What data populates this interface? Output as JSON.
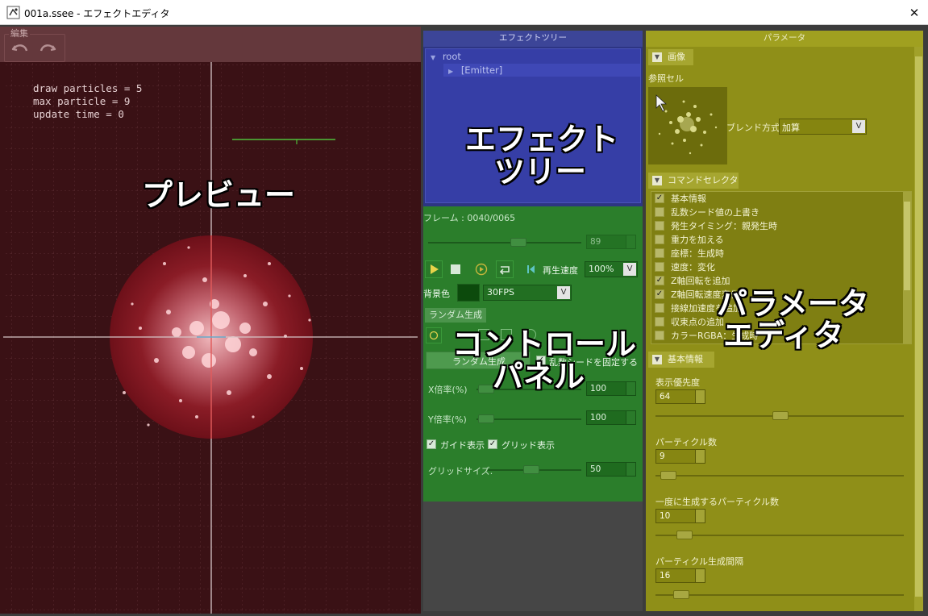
{
  "window": {
    "title": "001a.ssee - エフェクトエディタ",
    "close_glyph": "✕"
  },
  "preview": {
    "edit_group_label": "編集",
    "stats": [
      "draw particles = 5",
      "max particle = 9",
      "update time = 0"
    ],
    "overlay_label": "プレビュー"
  },
  "effect_tree": {
    "header": "エフェクトツリー",
    "root_label": "root",
    "child_label": "[Emitter]",
    "overlay_label": [
      "エフェクト",
      "ツリー"
    ]
  },
  "control_panel": {
    "frame_label": "フレーム : 0040/0065",
    "frame_value": "89",
    "playback_speed_label": "再生速度",
    "playback_speed_value": "100%",
    "background_color_label": "背景色",
    "background_color": "#0c4a0c",
    "fps_value": "30FPS",
    "random_tab": "ランダム生成",
    "random_button": "ランダム生成",
    "fix_seed_label": "乱数シードを固定する",
    "x_scale_label": "X倍率(%)",
    "x_scale_value": "100",
    "y_scale_label": "Y倍率(%)",
    "y_scale_value": "100",
    "guide_label": "ガイド表示",
    "grid_label": "グリッド表示",
    "grid_size_label": "グリッドサイズ:",
    "grid_size_value": "50",
    "overlay_label": [
      "コントロール",
      "パネル"
    ]
  },
  "parameters": {
    "header": "パラメータ",
    "image_section": "画像",
    "ref_cell_label": "参照セル",
    "blend_label": "ブレンド方式",
    "blend_value": "加算",
    "command_section": "コマンドセレクター",
    "commands": [
      {
        "label": "基本情報",
        "checked": true
      },
      {
        "label": "乱数シード値の上書き",
        "checked": false
      },
      {
        "label": "発生タイミング：親発生時",
        "checked": false
      },
      {
        "label": "重力を加える",
        "checked": false
      },
      {
        "label": "座標：生成時",
        "checked": false
      },
      {
        "label": "速度：変化",
        "checked": false
      },
      {
        "label": "Z軸回転を追加",
        "checked": true
      },
      {
        "label": "Z軸回転速度変化",
        "checked": true
      },
      {
        "label": "接線加速度を追加",
        "checked": false
      },
      {
        "label": "収束点の追加",
        "checked": false
      },
      {
        "label": "カラーRGBA：生成時",
        "checked": false
      }
    ],
    "basic_section": "基本情報",
    "fields": [
      {
        "label": "表示優先度",
        "value": "64"
      },
      {
        "label": "パーティクル数",
        "value": "9"
      },
      {
        "label": "一度に生成するパーティクル数",
        "value": "10"
      },
      {
        "label": "パーティクル生成間隔",
        "value": "16"
      }
    ],
    "overlay_label": [
      "パラメータ",
      "エディタ"
    ]
  }
}
